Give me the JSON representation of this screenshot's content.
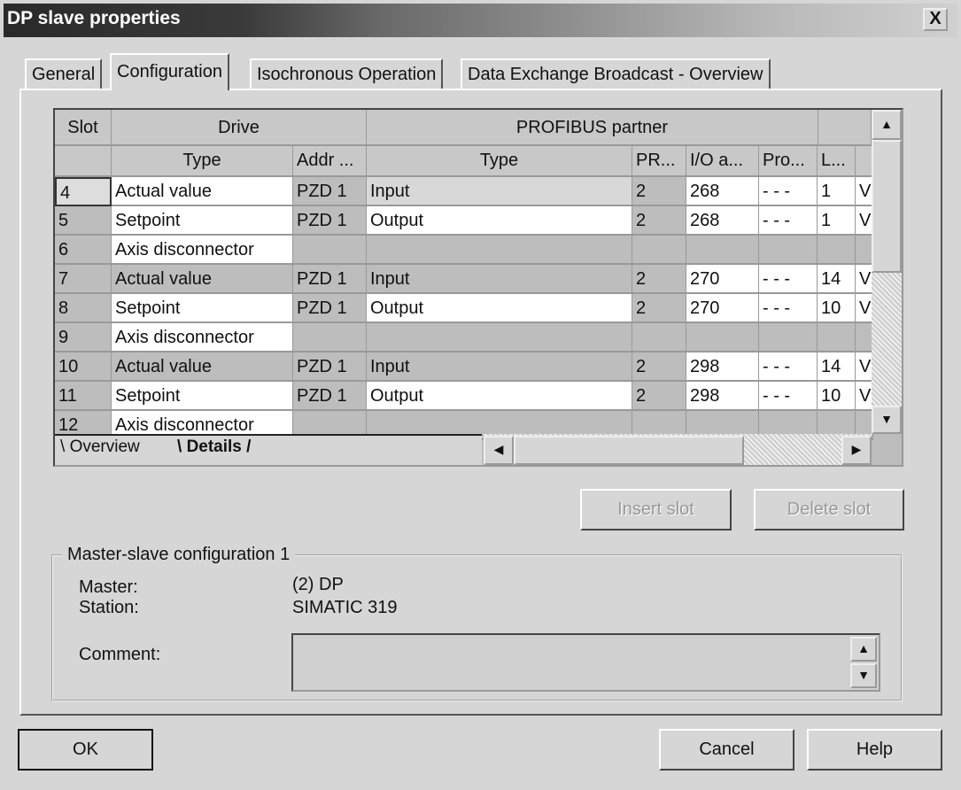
{
  "window": {
    "title": "DP slave properties",
    "close": "X"
  },
  "tabs": [
    "General",
    "Configuration",
    "Isochronous Operation",
    "Data Exchange Broadcast - Overview"
  ],
  "grid": {
    "group_headers": {
      "slot": "Slot",
      "drive": "Drive",
      "partner": "PROFIBUS partner"
    },
    "columns": [
      "Type",
      "Addr ...",
      "Type",
      "PR...",
      "I/O a...",
      "Pro...",
      "L..."
    ],
    "rows": [
      {
        "slot": "4",
        "drive_type": "Actual value",
        "addr": "PZD 1",
        "type": "Input",
        "pr": "2",
        "io": "268",
        "pro": "- - -",
        "l": "1",
        "u": "V"
      },
      {
        "slot": "5",
        "drive_type": "Setpoint",
        "addr": "PZD 1",
        "type": "Output",
        "pr": "2",
        "io": "268",
        "pro": "- - -",
        "l": "1",
        "u": "V"
      },
      {
        "slot": "6",
        "drive_type": "Axis disconnector",
        "addr": "",
        "type": "",
        "pr": "",
        "io": "",
        "pro": "",
        "l": "",
        "u": ""
      },
      {
        "slot": "7",
        "drive_type": "Actual value",
        "addr": "PZD 1",
        "type": "Input",
        "pr": "2",
        "io": "270",
        "pro": "- - -",
        "l": "14",
        "u": "V"
      },
      {
        "slot": "8",
        "drive_type": "Setpoint",
        "addr": "PZD 1",
        "type": "Output",
        "pr": "2",
        "io": "270",
        "pro": "- - -",
        "l": "10",
        "u": "V"
      },
      {
        "slot": "9",
        "drive_type": "Axis disconnector",
        "addr": "",
        "type": "",
        "pr": "",
        "io": "",
        "pro": "",
        "l": "",
        "u": ""
      },
      {
        "slot": "10",
        "drive_type": "Actual value",
        "addr": "PZD 1",
        "type": "Input",
        "pr": "2",
        "io": "298",
        "pro": "- - -",
        "l": "14",
        "u": "V"
      },
      {
        "slot": "11",
        "drive_type": "Setpoint",
        "addr": "PZD 1",
        "type": "Output",
        "pr": "2",
        "io": "298",
        "pro": "- - -",
        "l": "10",
        "u": "V"
      },
      {
        "slot": "12",
        "drive_type": "Axis disconnector",
        "addr": "",
        "type": "",
        "pr": "",
        "io": "",
        "pro": "",
        "l": "",
        "u": ""
      }
    ],
    "sheet_tabs": [
      "Overview",
      "Details"
    ]
  },
  "buttons": {
    "insert_slot": "Insert slot",
    "delete_slot": "Delete slot",
    "ok": "OK",
    "cancel": "Cancel",
    "help": "Help"
  },
  "group": {
    "title": "Master-slave configuration 1",
    "master_label": "Master:",
    "master_value": "(2) DP",
    "station_label": "Station:",
    "station_value": "SIMATIC 319",
    "comment_label": "Comment:",
    "comment_value": ""
  }
}
